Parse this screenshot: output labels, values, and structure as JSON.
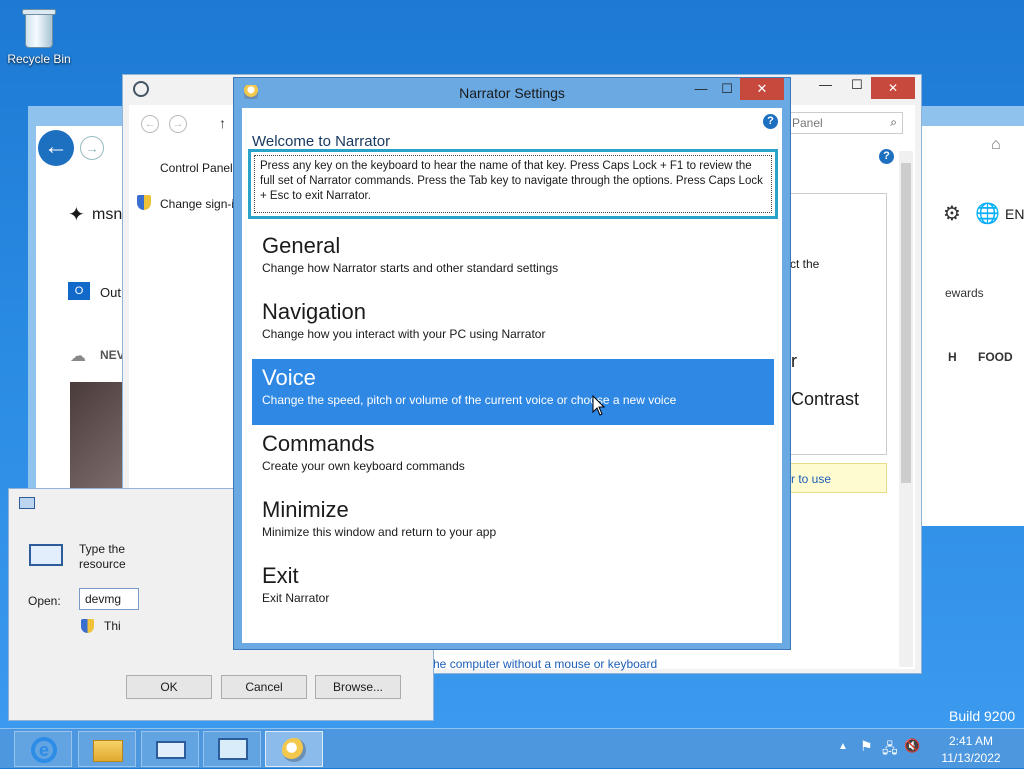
{
  "desktop": {
    "recycle_bin_label": "Recycle Bin",
    "build_label": "Build 9200"
  },
  "browser_bg": {
    "msn_label": "msn",
    "outlook_label": "Out",
    "news_label": "NEV",
    "rewards_label": "ewards",
    "food_label": "FOOD",
    "h_label": "H",
    "en_label": "EN"
  },
  "control_panel_bg": {
    "crumb": "Control Panel",
    "change_signin": "Change sign-i",
    "search_placeholder": "Panel",
    "right_text_1": "ct the",
    "right_text_2": "r",
    "right_text_3": "Contrast",
    "right_link": "r to use",
    "bottom_link": "Use the computer without a mouse or keyboard"
  },
  "run_dialog": {
    "desc_line1": "Type the",
    "desc_line2": "resource",
    "open_label": "Open:",
    "open_value": "devmg",
    "admin_note": "Thi",
    "ok": "OK",
    "cancel": "Cancel",
    "browse": "Browse..."
  },
  "narrator": {
    "title": "Narrator Settings",
    "minimize_glyph": "—",
    "maximize_glyph": "☐",
    "close_glyph": "✕",
    "help_glyph": "?",
    "welcome": "Welcome to Narrator",
    "instructions": "Press any key on the keyboard to hear the name of that key.  Press Caps Lock + F1 to review the full set of Narrator commands.  Press the Tab key to navigate through the options.  Press Caps Lock + Esc to exit Narrator.",
    "items": [
      {
        "title": "General",
        "desc": "Change how Narrator starts and other standard settings",
        "selected": false
      },
      {
        "title": "Navigation",
        "desc": "Change how you interact with your PC using Narrator",
        "selected": false
      },
      {
        "title": "Voice",
        "desc": "Change the speed, pitch or volume of the current voice or choose a new voice",
        "selected": true
      },
      {
        "title": "Commands",
        "desc": "Create your own keyboard commands",
        "selected": false
      },
      {
        "title": "Minimize",
        "desc": "Minimize this window and return to your app",
        "selected": false
      },
      {
        "title": "Exit",
        "desc": "Exit Narrator",
        "selected": false
      }
    ]
  },
  "taskbar": {
    "time": "2:41 AM",
    "date": "11/13/2022",
    "buttons": [
      "internet-explorer-icon",
      "file-explorer-icon",
      "run-icon",
      "control-panel-icon",
      "narrator-icon"
    ]
  },
  "colors": {
    "accent": "#2e88e4",
    "close": "#c7483d",
    "focus_border": "#2aa3c9"
  }
}
